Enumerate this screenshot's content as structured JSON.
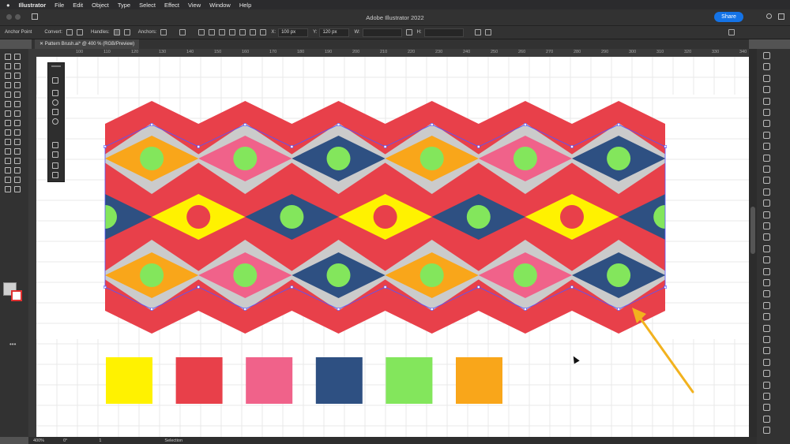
{
  "menubar": {
    "apple_icon": "apple-icon",
    "items": [
      "Illustrator",
      "File",
      "Edit",
      "Object",
      "Type",
      "Select",
      "Effect",
      "View",
      "Window",
      "Help"
    ]
  },
  "titlebar": {
    "title": "Adobe Illustrator 2022",
    "share_label": "Share"
  },
  "control": {
    "tool_label": "Anchor Point",
    "convert_label": "Convert:",
    "handles_label": "Handles:",
    "anchors_label": "Anchors:",
    "x_label": "X:",
    "x_value": "100 px",
    "y_label": "Y:",
    "y_value": "120 px",
    "w_label": "W:",
    "h_label": "H:"
  },
  "document": {
    "tab_label": "Pattern Brush.ai* @ 400 % (RGB/Preview)"
  },
  "ruler": {
    "ticks": [
      "100",
      "110",
      "120",
      "130",
      "140",
      "150",
      "160",
      "170",
      "180",
      "190",
      "200",
      "210",
      "220",
      "230",
      "240",
      "250",
      "260",
      "270",
      "280",
      "290",
      "300",
      "310",
      "320",
      "330",
      "340"
    ]
  },
  "status": {
    "zoom": "400%",
    "rotation": "0°",
    "artboard": "1",
    "tool": "Selection"
  },
  "swatches": [
    "#FFF200",
    "#E8404A",
    "#F0628A",
    "#2E5082",
    "#83E65C",
    "#F9A61A"
  ],
  "colors": {
    "red": "#E8404A",
    "gray": "#CBCBCB",
    "orange": "#F9A61A",
    "pink": "#F0628A",
    "navy": "#2E5082",
    "yellow": "#FFF200",
    "green": "#83E65C",
    "arrow": "#F2B21E",
    "selection": "#5454ff"
  }
}
